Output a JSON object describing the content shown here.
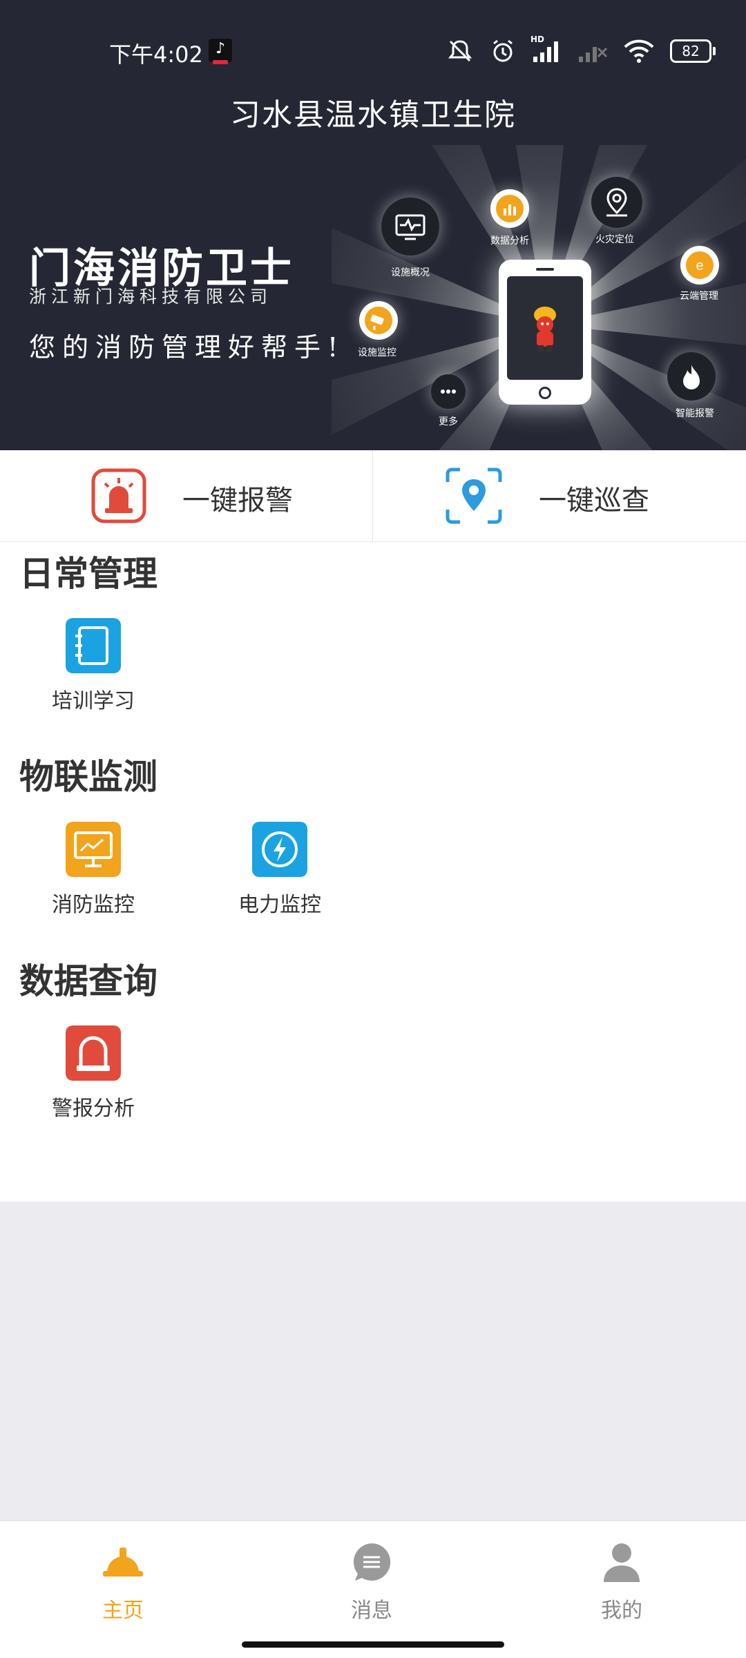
{
  "status_bar": {
    "time": "下午4:02",
    "network": "HD",
    "battery": "82"
  },
  "header": {
    "title": "习水县温水镇卫生院"
  },
  "banner": {
    "brand_title": "门海消防卫士",
    "company": "浙江新门海科技有限公司",
    "slogan": "您的消防管理好帮手!",
    "nodes": {
      "facility_overview": "设施概况",
      "data_analysis": "数据分析",
      "fire_location": "火灾定位",
      "cloud_management": "云端管理",
      "facility_monitor": "设施监控",
      "more": "更多",
      "smart_alarm": "智能报警"
    }
  },
  "quick_actions": {
    "alarm": {
      "label": "一键报警",
      "color": "#e14b3b"
    },
    "patrol": {
      "label": "一键巡查",
      "color": "#2d9be0"
    }
  },
  "sections": {
    "daily": {
      "title": "日常管理",
      "items": [
        {
          "label": "培训学习",
          "icon": "notebook-icon",
          "color": "#1aa3e0"
        }
      ]
    },
    "iot": {
      "title": "物联监测",
      "items": [
        {
          "label": "消防监控",
          "icon": "monitor-chart-icon",
          "color": "#f2a41c"
        },
        {
          "label": "电力监控",
          "icon": "lightning-icon",
          "color": "#1aa3e0"
        }
      ]
    },
    "query": {
      "title": "数据查询",
      "items": [
        {
          "label": "警报分析",
          "icon": "alarm-light-icon",
          "color": "#e14b3b"
        }
      ]
    }
  },
  "bottom_nav": {
    "home": {
      "label": "主页",
      "active": true,
      "color": "#f2a41c"
    },
    "messages": {
      "label": "消息",
      "active": false,
      "color": "#888888"
    },
    "mine": {
      "label": "我的",
      "active": false,
      "color": "#888888"
    }
  }
}
